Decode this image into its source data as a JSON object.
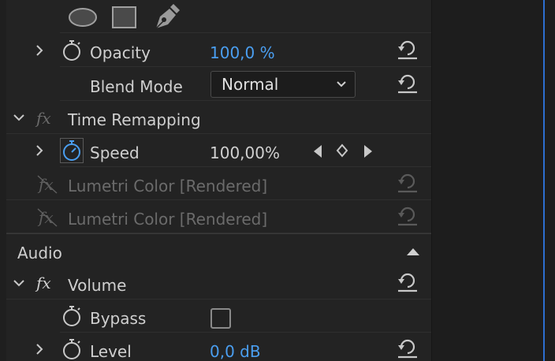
{
  "effects": {
    "opacity": {
      "label": "Opacity",
      "value": "100,0 %"
    },
    "blend_mode": {
      "label": "Blend Mode",
      "value": "Normal"
    },
    "time_remapping": {
      "label": "Time Remapping"
    },
    "speed": {
      "label": "Speed",
      "value": "100,00%"
    },
    "lumetri_1": {
      "label": "Lumetri Color [Rendered]"
    },
    "lumetri_2": {
      "label": "Lumetri Color [Rendered]"
    }
  },
  "audio": {
    "section_label": "Audio",
    "volume": {
      "label": "Volume"
    },
    "bypass": {
      "label": "Bypass",
      "checked": false
    },
    "level": {
      "label": "Level",
      "value": "0,0 dB"
    }
  },
  "fx_glyph": "fx",
  "colors": {
    "accent": "#4a9ef0",
    "playhead": "#2d6fd0",
    "panel": "#232323",
    "dim_text": "#6b6b6b"
  },
  "icons": [
    "ellipse-mask-icon",
    "rectangle-mask-icon",
    "pen-mask-icon",
    "stopwatch-icon",
    "reset-icon",
    "keyframe-prev-icon",
    "keyframe-add-icon",
    "keyframe-next-icon",
    "chevron-right-icon",
    "chevron-down-icon",
    "collapse-up-icon"
  ]
}
